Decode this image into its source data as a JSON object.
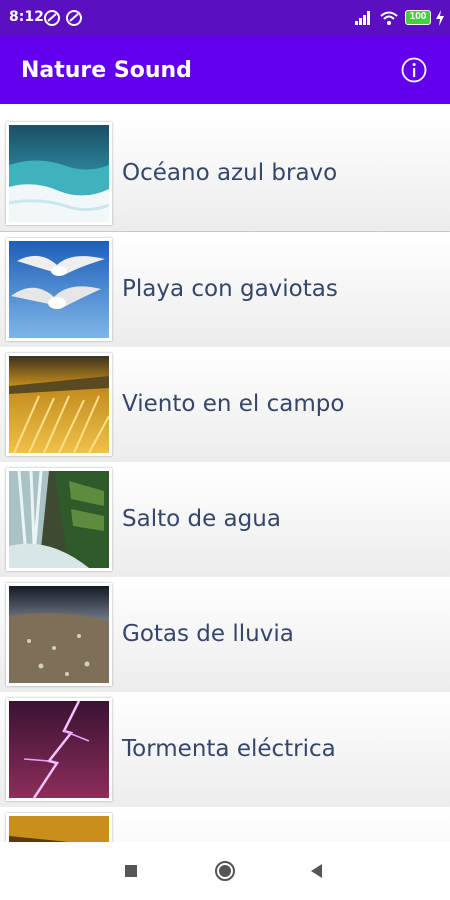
{
  "status_bar": {
    "time": "8:12",
    "battery": "100"
  },
  "app_bar": {
    "title": "Nature Sound",
    "info_icon": "info-icon"
  },
  "sounds": [
    {
      "label": "Océano azul bravo",
      "thumb": "ocean-wave-thumbnail"
    },
    {
      "label": "Playa con gaviotas",
      "thumb": "seagulls-thumbnail"
    },
    {
      "label": "Viento en el campo",
      "thumb": "wheat-field-thumbnail"
    },
    {
      "label": "Salto de agua",
      "thumb": "waterfall-thumbnail"
    },
    {
      "label": "Gotas de lluvia",
      "thumb": "rain-drops-thumbnail"
    },
    {
      "label": "Tormenta eléctrica",
      "thumb": "lightning-storm-thumbnail"
    },
    {
      "label": "",
      "thumb": "partial-thumbnail"
    }
  ],
  "nav_bar": {
    "buttons": [
      "recents-icon",
      "home-icon",
      "back-icon"
    ]
  },
  "colors": {
    "status_bar": "#5b0fc0",
    "app_bar": "#6200ee",
    "label_text": "#34476a"
  }
}
